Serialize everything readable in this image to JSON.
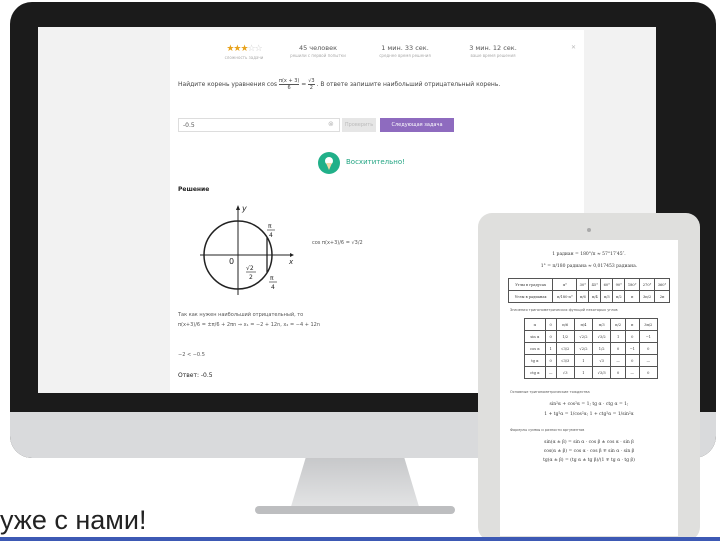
{
  "card": {
    "stats": [
      {
        "value": "45 человек",
        "sub": "решили с первой попытки"
      },
      {
        "value": "1 мин. 33 сек.",
        "sub": "среднее время решения"
      },
      {
        "value": "3 мин. 12 сек.",
        "sub": "ваше время решения"
      }
    ],
    "difficulty_sub": "сложность задачи",
    "task_prefix": "Найдите корень уравнения cos",
    "task_frac_num": "π(x + 3)",
    "task_frac_den": "6",
    "task_rhs_num": "√3",
    "task_rhs_den": "2",
    "task_suffix": ". В ответе запишите наибольший отрицательный корень.",
    "answer_value": "-0.5",
    "check_label": "Проверить",
    "next_label": "Следующая задача",
    "excellent_text": "Восхитительно!",
    "solution_title": "Решение",
    "eq_right": "cos π(x+3)/6 = √3/2",
    "line1": "Так как нужен наибольший отрицательный, то",
    "line2": "π(x+3)/6 = ±π/6 + 2πn ⇒ x₁ = −2 + 12n, x₂ = −4 + 12n",
    "line3": "−2 < −0.5",
    "answer_label": "Ответ: -0.5"
  },
  "tablet": {
    "line1": "1 радиан = 180°/π ≈ 57°17′45″.",
    "line2": "1° = π/180 радиана ≈ 0,017453 радиана.",
    "table1_head": [
      "Углы в градусах",
      "α°",
      "30°",
      "45°",
      "60°",
      "90°",
      "180°",
      "270°",
      "360°"
    ],
    "table1_row": [
      "Углы в радианах",
      "π/180·α°",
      "π/6",
      "π/4",
      "π/3",
      "π/2",
      "π",
      "3π/2",
      "2π"
    ],
    "caption2": "Значения тригонометрических функций некоторых углов",
    "table2": [
      [
        "α",
        "0",
        "π/6",
        "π/4",
        "π/3",
        "π/2",
        "π",
        "3π/2"
      ],
      [
        "sin α",
        "0",
        "1/2",
        "√2/2",
        "√3/2",
        "1",
        "0",
        "−1"
      ],
      [
        "cos α",
        "1",
        "√3/2",
        "√2/2",
        "1/2",
        "0",
        "−1",
        "0"
      ],
      [
        "tg α",
        "0",
        "√3/3",
        "1",
        "√3",
        "—",
        "0",
        "—"
      ],
      [
        "ctg α",
        "—",
        "√3",
        "1",
        "√3/3",
        "0",
        "—",
        "0"
      ]
    ],
    "caption3": "Основные тригонометрические тождества",
    "id1": "sin²α + cos²α = 1;   tg α · ctg α = 1;",
    "id2": "1 + tg²α = 1/cos²α;   1 + ctg²α = 1/sin²α",
    "caption4": "Формулы суммы и разности аргументов",
    "f1": "sin(α ± β) = sin α · cos β ± cos α · sin β",
    "f2": "cos(α ± β) = cos α · cos β ∓ sin α · sin β",
    "f3": "tg(α ± β) = (tg α ± tg β)/(1 ∓ tg α · tg β)"
  },
  "bottom_text": "уже с нами!",
  "colors": {
    "accent": "#8e6bbf",
    "success": "#21b089",
    "star": "#e8a31d",
    "bar": "#3d59b4"
  }
}
